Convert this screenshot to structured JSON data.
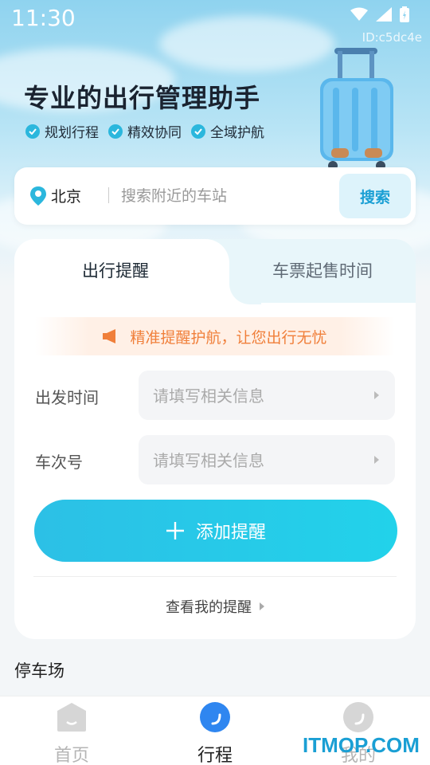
{
  "status_bar": {
    "time": "11:30",
    "id_tag": "ID:c5dc4e"
  },
  "hero": {
    "headline": "专业的出行管理助手",
    "features": [
      "规划行程",
      "精效协同",
      "全域护航"
    ]
  },
  "search": {
    "city": "北京",
    "placeholder": "搜索附近的车站",
    "button_label": "搜索"
  },
  "card": {
    "tabs": [
      "出行提醒",
      "车票起售时间"
    ],
    "notice": "精准提醒护航，让您出行无忧",
    "fields": [
      {
        "label": "出发时间",
        "placeholder": "请填写相关信息"
      },
      {
        "label": "车次号",
        "placeholder": "请填写相关信息"
      }
    ],
    "add_button": "添加提醒",
    "view_link": "查看我的提醒"
  },
  "section_title": "停车场",
  "bottom_nav": [
    {
      "label": "首页",
      "icon": "home-icon"
    },
    {
      "label": "行程",
      "icon": "trip-icon"
    },
    {
      "label": "我的",
      "icon": "profile-icon"
    }
  ],
  "watermark": "ITMOP.COM",
  "colors": {
    "accent": "#2bb7dd",
    "notice": "#f07f3a",
    "active_nav": "#2f86f0"
  }
}
